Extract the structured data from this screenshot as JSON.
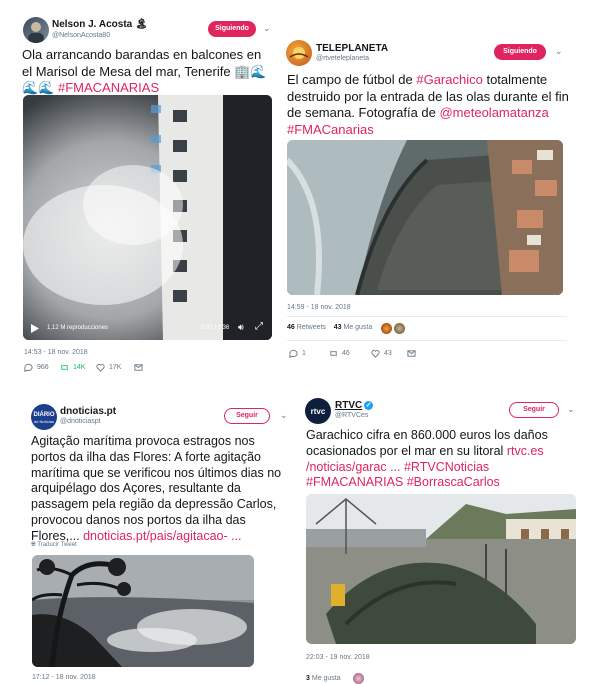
{
  "tweets": [
    {
      "author": "Nelson J. Acosta",
      "author_badge": "🏝",
      "handle": "@NelsonAcosta80",
      "follow_label": "Siguiendo",
      "text_main": "Ola arrancando barandas en balcones en el Marisol de Mesa del mar, Tenerife 🏢🌊🌊🌊",
      "hashtag": "#FMACANARIAS",
      "video": {
        "views": "1,12 M reproducciones",
        "time": "0:07 / 0:36"
      },
      "timestamp": "14:53 - 18 nov. 2018",
      "replies": "966",
      "retweets": "14K",
      "likes": "17K"
    },
    {
      "author": "TELEPLANETA",
      "handle": "@rtveteleplaneta",
      "follow_label": "Siguiendo",
      "text_1": "El campo de fútbol de ",
      "hashtag_1": "#Garachico",
      "text_2": " totalmente destruido por la entrada de las olas durante el fin de semana. Fotografía de ",
      "mention": "@meteolamatanza",
      "hashtag_2": " #FMACanarias",
      "timestamp": "14:59 - 18 nov. 2018",
      "retweet_count": "46",
      "retweet_word": "Retweets",
      "like_count": "43",
      "like_word": "Me gusta",
      "replies": "1",
      "retweets": "46",
      "likes": "43"
    },
    {
      "author": "dnoticias.pt",
      "handle": "@dnoticiaspt",
      "follow_label": "Seguir",
      "text_main": "Agitação marítima provoca estragos nos portos da ilha das Flores: A forte agitação marítima que se verificou nos últimos dias no arquipélago dos Açores, resultante da passagem pela região da depressão Carlos, provocou danos nos portos da ilha das Flores,...",
      "link": " dnoticias.pt/pais/agitacao-    ...",
      "translate": "Traducir Tweet",
      "timestamp": "17:12 - 18 nov. 2018"
    },
    {
      "author": "RTVC",
      "handle": "@RTVCes",
      "follow_label": "Seguir",
      "text_main": "Garachico cifra en 860.000 euros los daños ocasionados por el mar en su litoral ",
      "link": "rtvc.es /noticias/garac     ...",
      "hashtags": " #RTVCNoticias #FMACANARIAS #BorrascaCarlos",
      "timestamp": "22:03 - 19 nov. 2018",
      "like_count": "3",
      "like_word": "Me gusta"
    }
  ],
  "colors": {
    "accent": "#e0245e",
    "muted": "#657786",
    "retweet_green": "#17bf63",
    "verified_blue": "#1da1f2"
  }
}
